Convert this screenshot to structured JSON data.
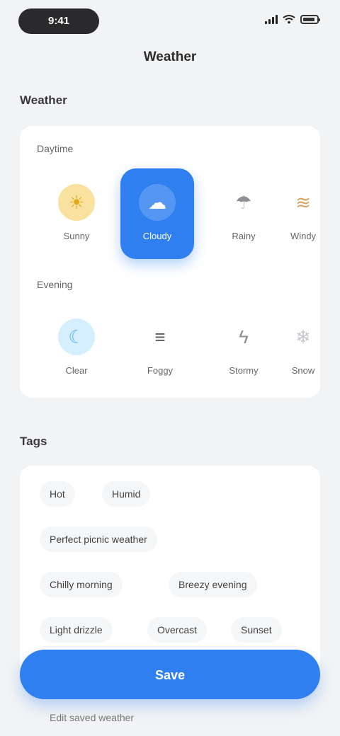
{
  "status_bar": {
    "time": "9:41"
  },
  "page": {
    "title": "Weather"
  },
  "sections": {
    "conditions": "Weather",
    "tags": "Tags"
  },
  "groups": [
    {
      "label": "Daytime",
      "options": [
        {
          "label": "Sunny",
          "icon": "sun-icon",
          "color": "#f4c542",
          "selected": false
        },
        {
          "label": "Cloudy",
          "icon": "cloud-icon",
          "color": "#ffffff",
          "selected": true
        },
        {
          "label": "Rainy",
          "icon": "umbrella-icon",
          "color": "#8e8e93",
          "selected": false
        },
        {
          "label": "Windy",
          "icon": "wind-icon",
          "color": "#d9a560",
          "selected": false
        }
      ]
    },
    {
      "label": "Evening",
      "options": [
        {
          "label": "Clear",
          "icon": "moon-icon",
          "color": "#7cc4f0",
          "selected": false
        },
        {
          "label": "Foggy",
          "icon": "fog-icon",
          "color": "#5a5a5e",
          "selected": false
        },
        {
          "label": "Stormy",
          "icon": "lightning-icon",
          "color": "#8e8e93",
          "selected": false
        },
        {
          "label": "Snow",
          "icon": "snow-icon",
          "color": "#c7c7cc",
          "selected": false
        }
      ]
    }
  ],
  "tags": [
    [
      "Hot",
      "Humid"
    ],
    [
      "Perfect picnic weather"
    ],
    [
      "Chilly morning",
      "Breezy evening"
    ],
    [
      "Light drizzle",
      "Overcast",
      "Sunset"
    ]
  ],
  "primary_button": "Save",
  "footer": "Edit saved weather"
}
